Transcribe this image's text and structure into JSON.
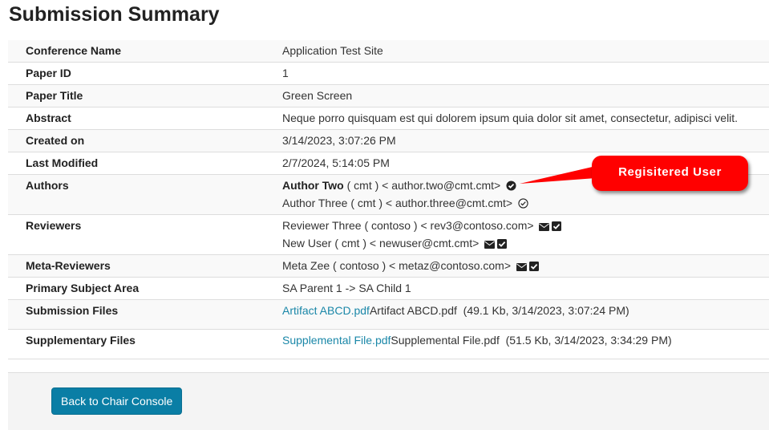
{
  "page": {
    "title": "Submission Summary"
  },
  "rows": {
    "conference_name": {
      "label": "Conference Name",
      "value": "Application Test Site"
    },
    "paper_id": {
      "label": "Paper ID",
      "value": "1"
    },
    "paper_title": {
      "label": "Paper Title",
      "value": "Green Screen"
    },
    "abstract": {
      "label": "Abstract",
      "value": "Neque porro quisquam est qui dolorem ipsum quia dolor sit amet, consectetur, adipisci velit."
    },
    "created_on": {
      "label": "Created on",
      "value": "3/14/2023, 3:07:26 PM"
    },
    "last_modified": {
      "label": "Last Modified",
      "value": "2/7/2024, 5:14:05 PM"
    },
    "authors": {
      "label": "Authors",
      "items": [
        {
          "name": "Author Two",
          "org": " ( cmt ) ",
          "email": "< author.two@cmt.cmt>",
          "icon": "check-circle-filled-icon",
          "registered": true
        },
        {
          "name": "Author Three",
          "org": " ( cmt ) ",
          "email": "< author.three@cmt.cmt>",
          "icon": "check-circle-outline-icon",
          "registered": false
        }
      ]
    },
    "reviewers": {
      "label": "Reviewers",
      "items": [
        {
          "text": "Reviewer Three ( contoso ) < rev3@contoso.com>",
          "icons": [
            "envelope-icon",
            "checkbox-checked-icon"
          ]
        },
        {
          "text": "New User ( cmt ) < newuser@cmt.cmt>",
          "icons": [
            "envelope-icon",
            "checkbox-checked-icon"
          ]
        }
      ]
    },
    "meta_reviewers": {
      "label": "Meta-Reviewers",
      "items": [
        {
          "text": "Meta Zee ( contoso ) < metaz@contoso.com>",
          "icons": [
            "envelope-icon",
            "checkbox-checked-icon"
          ]
        }
      ]
    },
    "primary_subject_area": {
      "label": "Primary Subject Area",
      "value": "SA Parent 1 -> SA Child 1"
    },
    "submission_files": {
      "label": "Submission Files",
      "link": "Artifact ABCD.pdf",
      "name": "Artifact ABCD.pdf",
      "details": "  (49.1 Kb, 3/14/2023, 3:07:24 PM)"
    },
    "supplementary_files": {
      "label": "Supplementary Files",
      "link": "Supplemental File.pdf",
      "name": "Supplemental File.pdf",
      "details": "  (51.5 Kb, 3/14/2023, 3:34:29 PM)"
    }
  },
  "callout": {
    "text": "Regisitered User",
    "color": "#ff0000"
  },
  "footer": {
    "back_button": "Back to Chair Console"
  },
  "colors": {
    "link": "#1a87a8",
    "button": "#0a7ea5",
    "row_alt": "#f9f9f9",
    "footer_bg": "#f4f4f4"
  }
}
